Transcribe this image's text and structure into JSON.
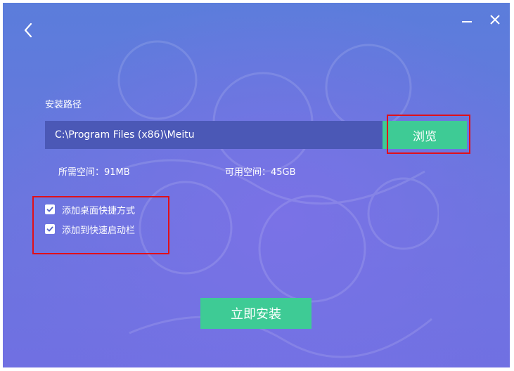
{
  "window": {
    "back_icon": "chevron-left-icon",
    "minimize_icon": "minimize-icon",
    "close_icon": "close-icon"
  },
  "install": {
    "path_label": "安装路径",
    "path_value": "C:\\Program Files (x86)\\Meitu",
    "browse_label": "浏览",
    "required_space": "所需空间：91MB",
    "available_space": "可用空间：45GB",
    "options": [
      {
        "label": "添加桌面快捷方式",
        "checked": true
      },
      {
        "label": "添加到快速启动栏",
        "checked": true
      }
    ],
    "install_label": "立即安装"
  },
  "colors": {
    "accent": "#3ecb95",
    "background": "#6a76de",
    "input_background": "#4b58b6",
    "highlight": "#e0101a"
  }
}
